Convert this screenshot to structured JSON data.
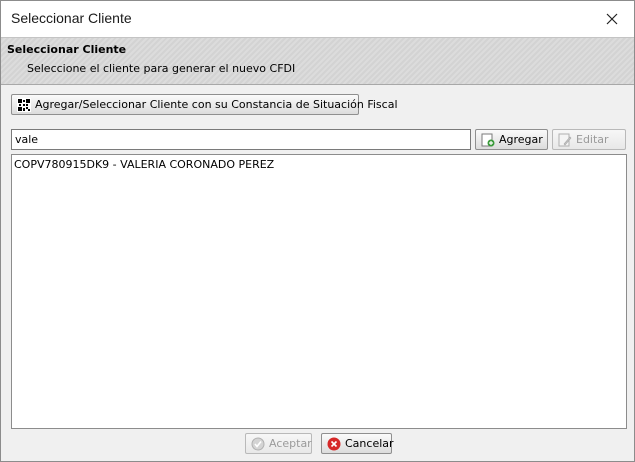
{
  "window": {
    "title": "Seleccionar Cliente"
  },
  "header": {
    "title": "Seleccionar Cliente",
    "subtitle": "Seleccione el cliente para generar el nuevo CFDI"
  },
  "toolbar": {
    "qr_button_label": "Agregar/Seleccionar Cliente con su Constancia de Situación Fiscal",
    "add_label": "Agregar",
    "edit_label": "Editar"
  },
  "search": {
    "value": "vale"
  },
  "clients": [
    {
      "label": "COPV780915DK9 - VALERIA CORONADO PEREZ"
    }
  ],
  "footer": {
    "accept_label": "Aceptar",
    "cancel_label": "Cancelar"
  },
  "colors": {
    "cancel_icon": "#d62828",
    "add_icon": "#3a9a3a"
  }
}
